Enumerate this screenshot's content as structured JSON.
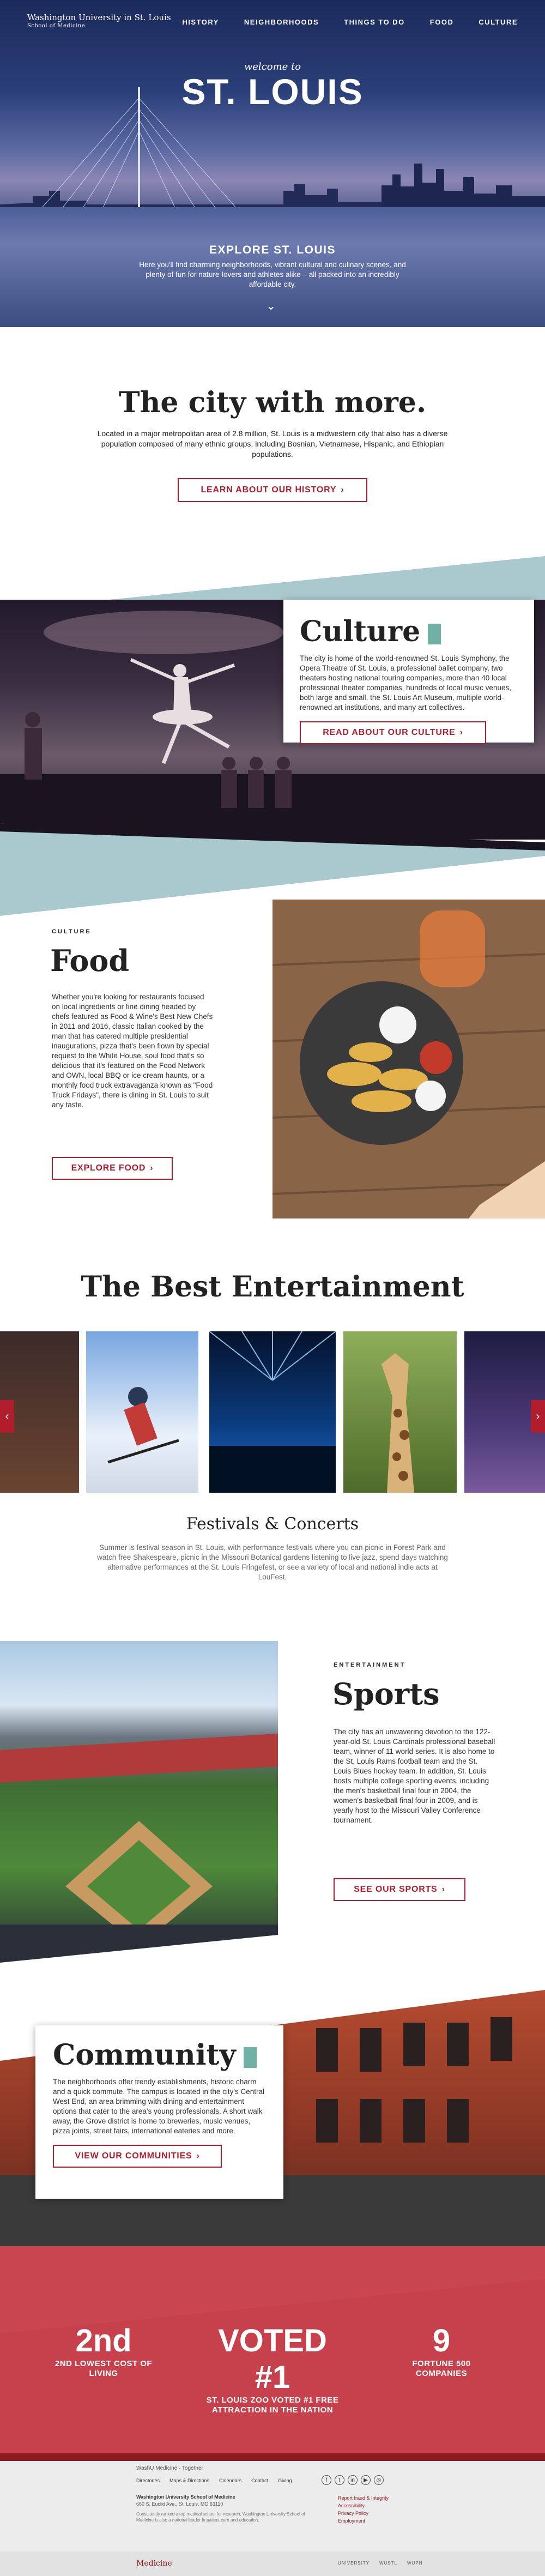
{
  "header": {
    "logo_line1": "Washington University in St. Louis",
    "logo_line2": "School of Medicine",
    "nav": [
      "HISTORY",
      "NEIGHBORHOODS",
      "THINGS TO DO",
      "FOOD",
      "CULTURE"
    ]
  },
  "hero": {
    "welcome": "welcome to",
    "city": "ST. LOUIS",
    "explore": "EXPLORE ST. LOUIS",
    "description": "Here you'll find charming neighborhoods, vibrant cultural and culinary scenes, and plenty of fun for nature-lovers and athletes alike – all packed into an incredibly affordable city."
  },
  "intro": {
    "title": "The city with more.",
    "text": "Located in a major metropolitan area of 2.8 million, St. Louis is a midwestern city that also has a diverse population composed of many ethnic groups, including Bosnian, Vietnamese, Hispanic, and Ethiopian populations.",
    "button": "LEARN ABOUT OUR HISTORY"
  },
  "culture": {
    "title": "Culture",
    "text": "The city is home of the world-renowned St. Louis Symphony, the Opera Theatre of St. Louis, a professional ballet company, two theaters hosting national touring companies, more than 40 local professional theater companies, hundreds of local music venues, both large and small, the St. Louis Art Museum, multiple world-renowned art institutions, and many art collectives.",
    "button": "READ ABOUT OUR CULTURE"
  },
  "food": {
    "eyebrow": "CULTURE",
    "title": "Food",
    "text": "Whether you're looking for restaurants focused on local ingredients or fine dining headed by chefs featured as Food & Wine's Best New Chefs in 2011 and 2016, classic Italian cooked by the man that has catered multiple presidential inaugurations, pizza that's been flown by special request to the White House, soul food that's so delicious that it's featured on the Food Network and OWN, local BBQ or ice cream haunts, or a monthly food truck extravaganza known as \"Food Truck Fridays\", there is dining in St. Louis to suit any taste.",
    "button": "EXPLORE FOOD"
  },
  "entertainment": {
    "title": "The Best Entertainment",
    "subtitle": "Festivals & Concerts",
    "text": "Summer is festival season in St. Louis, with performance festivals where you can picnic in Forest Park and watch free Shakespeare, picnic in the Missouri Botanical gardens listening to live jazz, spend days watching alternative performances at the St. Louis Fringefest, or see a variety of local and national indie acts at LouFest.",
    "prev": "‹",
    "next": "›"
  },
  "sports": {
    "eyebrow": "ENTERTAINMENT",
    "title": "Sports",
    "text": "The city has an unwavering devotion to the 122-year-old St. Louis Cardinals professional baseball team, winner of 11 world series. It is also home to the St. Louis Rams football team and the St. Louis Blues hockey team. In addition, St. Louis hosts multiple college sporting events, including the men's basketball final four in 2004, the women's basketball final four in 2009, and is yearly host to the Missouri Valley Conference tournament.",
    "button": "SEE OUR SPORTS"
  },
  "community": {
    "title": "Community",
    "text": "The neighborhoods offer trendy establishments, historic charm and a quick commute. The campus is located in the city's Central West End, an area brimming with dining and entertainment options that cater to the area's young professionals. A short walk away, the Grove district is home to breweries, music venues, pizza joints, street fairs, international eateries and more.",
    "button": "VIEW OUR COMMUNITIES"
  },
  "stats": [
    {
      "big": "2nd",
      "label": "2ND LOWEST COST OF LIVING"
    },
    {
      "big": "VOTED #1",
      "label": "ST. LOUIS ZOO VOTED #1 FREE ATTRACTION IN THE NATION"
    },
    {
      "big": "9",
      "label": "FORTUNE 500 COMPANIES"
    }
  ],
  "footer": {
    "banner": "WashU Medicine · Together",
    "links": [
      "Directories",
      "Maps & Directions",
      "Calendars",
      "Contact",
      "Giving"
    ],
    "address_title": "Washington University School of Medicine",
    "address": "660 S. Euclid Ave., St. Louis, MO 63110",
    "blurb": "Consistently ranked a top medical school for research, Washington University School of Medicine is also a national leader in patient care and education.",
    "resources": [
      "Report fraud & Integrity",
      "Accessibility",
      "Privacy Policy",
      "Employment"
    ],
    "bottom_logo": "Medicine",
    "bottom_links": [
      "UNIVERSITY",
      "WUSTL",
      "WUPH"
    ]
  },
  "colors": {
    "accent_red": "#b01e2e",
    "teal": "#6fb1a5",
    "stats_red": "#c9454f"
  }
}
